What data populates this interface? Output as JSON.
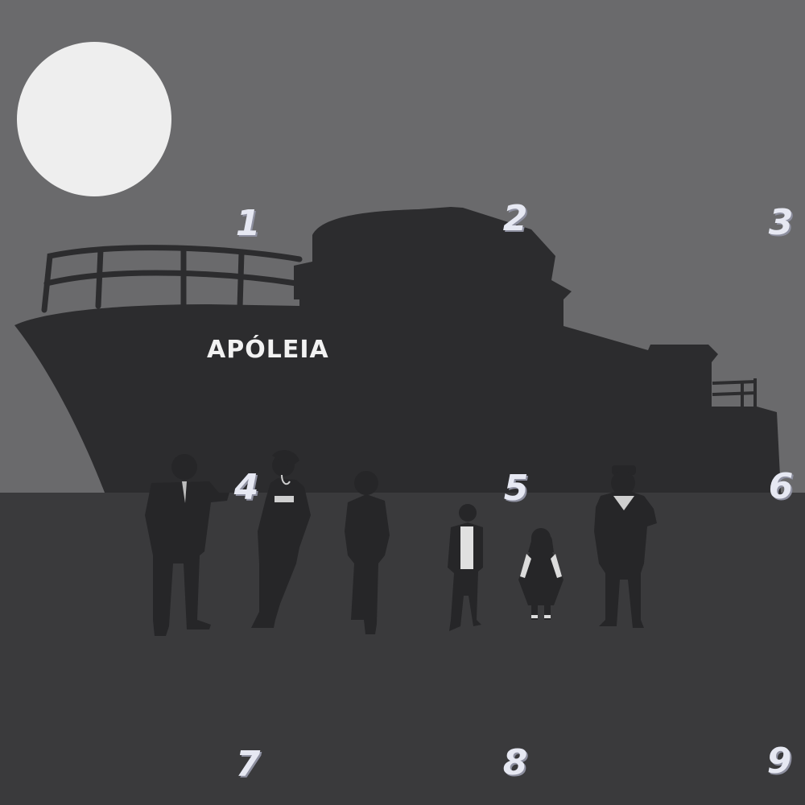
{
  "scene": {
    "ship_name": "APÓLEIA"
  },
  "grid_numbers": [
    "1",
    "2",
    "3",
    "4",
    "5",
    "6",
    "7",
    "8",
    "9"
  ],
  "characters": [
    "man-in-suit",
    "woman-in-dress",
    "young-man",
    "boy",
    "girl",
    "sailor"
  ],
  "colors": {
    "sky": "#6a6a6c",
    "ground": "#3a3a3c",
    "ship": "#2c2c2e",
    "moon": "#eeeeee",
    "silhouette": "#262628",
    "number": "#e6e8f2"
  }
}
